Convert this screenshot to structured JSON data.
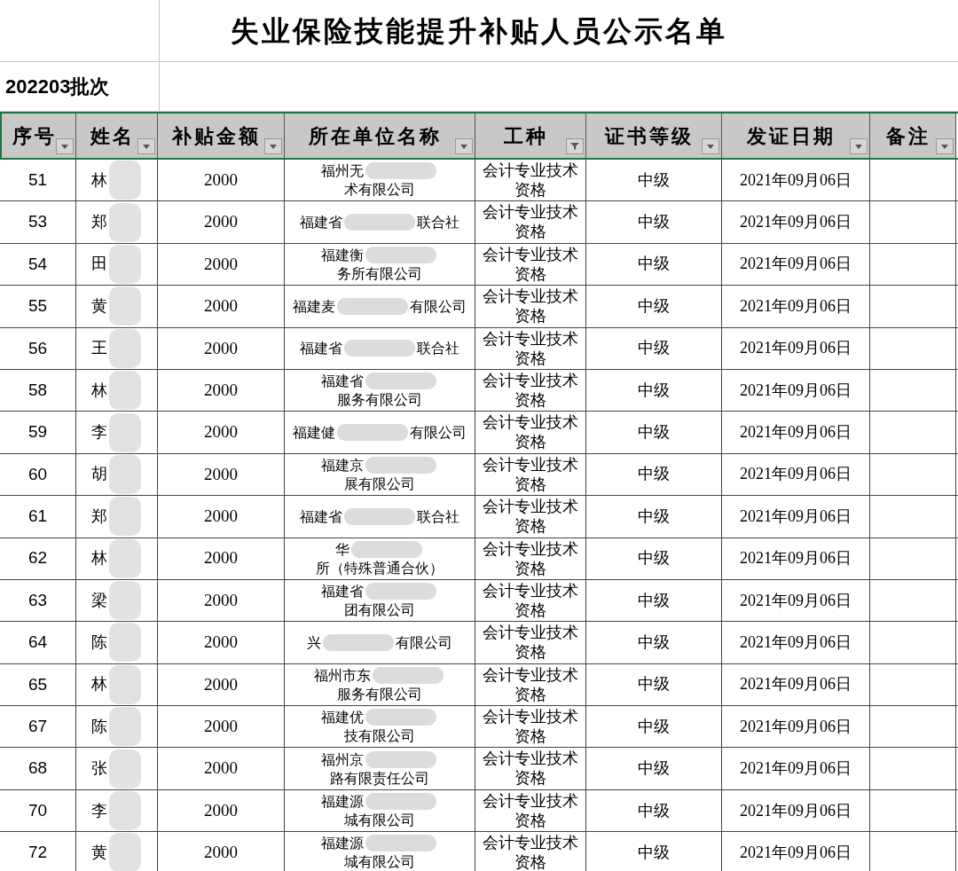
{
  "title": "失业保险技能提升补贴人员公示名单",
  "batch": "202203批次",
  "columns": [
    {
      "label": "序号",
      "filtered": false
    },
    {
      "label": "姓名",
      "filtered": false
    },
    {
      "label": "补贴金额",
      "filtered": false
    },
    {
      "label": "所在单位名称",
      "filtered": false
    },
    {
      "label": "工种",
      "filtered": true
    },
    {
      "label": "证书等级",
      "filtered": false
    },
    {
      "label": "发证日期",
      "filtered": false
    },
    {
      "label": "备注",
      "filtered": false
    }
  ],
  "rows": [
    {
      "no": "51",
      "name": "林",
      "amount": "2000",
      "company_start": "福州无",
      "company_end": "术有限公司",
      "trade": "会计专业技术资格",
      "level": "中级",
      "date": "2021年09月06日"
    },
    {
      "no": "53",
      "name": "郑",
      "amount": "2000",
      "company_start": "福建省",
      "company_end": "联合社",
      "trade": "会计专业技术资格",
      "level": "中级",
      "date": "2021年09月06日"
    },
    {
      "no": "54",
      "name": "田",
      "amount": "2000",
      "company_start": "福建衡",
      "company_end": "务所有限公司",
      "trade": "会计专业技术资格",
      "level": "中级",
      "date": "2021年09月06日"
    },
    {
      "no": "55",
      "name": "黄",
      "amount": "2000",
      "company_start": "福建麦",
      "company_end": "有限公司",
      "trade": "会计专业技术资格",
      "level": "中级",
      "date": "2021年09月06日"
    },
    {
      "no": "56",
      "name": "王",
      "amount": "2000",
      "company_start": "福建省",
      "company_end": "联合社",
      "trade": "会计专业技术资格",
      "level": "中级",
      "date": "2021年09月06日"
    },
    {
      "no": "58",
      "name": "林",
      "amount": "2000",
      "company_start": "福建省",
      "company_end": "服务有限公司",
      "trade": "会计专业技术资格",
      "level": "中级",
      "date": "2021年09月06日"
    },
    {
      "no": "59",
      "name": "李",
      "amount": "2000",
      "company_start": "福建健",
      "company_end": "有限公司",
      "trade": "会计专业技术资格",
      "level": "中级",
      "date": "2021年09月06日"
    },
    {
      "no": "60",
      "name": "胡",
      "amount": "2000",
      "company_start": "福建京",
      "company_end": "展有限公司",
      "trade": "会计专业技术资格",
      "level": "中级",
      "date": "2021年09月06日"
    },
    {
      "no": "61",
      "name": "郑",
      "amount": "2000",
      "company_start": "福建省",
      "company_end": "联合社",
      "trade": "会计专业技术资格",
      "level": "中级",
      "date": "2021年09月06日"
    },
    {
      "no": "62",
      "name": "林",
      "amount": "2000",
      "company_start": "华",
      "company_end": "所（特殊普通合伙）",
      "trade": "会计专业技术资格",
      "level": "中级",
      "date": "2021年09月06日"
    },
    {
      "no": "63",
      "name": "梁",
      "amount": "2000",
      "company_start": "福建省",
      "company_end": "团有限公司",
      "trade": "会计专业技术资格",
      "level": "中级",
      "date": "2021年09月06日"
    },
    {
      "no": "64",
      "name": "陈",
      "amount": "2000",
      "company_start": "兴",
      "company_end": "有限公司",
      "trade": "会计专业技术资格",
      "level": "中级",
      "date": "2021年09月06日"
    },
    {
      "no": "65",
      "name": "林",
      "amount": "2000",
      "company_start": "福州市东",
      "company_end": "服务有限公司",
      "trade": "会计专业技术资格",
      "level": "中级",
      "date": "2021年09月06日"
    },
    {
      "no": "67",
      "name": "陈",
      "amount": "2000",
      "company_start": "福建优",
      "company_end": "技有限公司",
      "trade": "会计专业技术资格",
      "level": "中级",
      "date": "2021年09月06日"
    },
    {
      "no": "68",
      "name": "张",
      "amount": "2000",
      "company_start": "福州京",
      "company_end": "路有限责任公司",
      "trade": "会计专业技术资格",
      "level": "中级",
      "date": "2021年09月06日"
    },
    {
      "no": "70",
      "name": "李",
      "amount": "2000",
      "company_start": "福建源",
      "company_end": "城有限公司",
      "trade": "会计专业技术资格",
      "level": "中级",
      "date": "2021年09月06日"
    },
    {
      "no": "72",
      "name": "黄",
      "amount": "2000",
      "company_start": "福建源",
      "company_end": "城有限公司",
      "trade": "会计专业技术资格",
      "level": "中级",
      "date": "2021年09月06日"
    }
  ]
}
